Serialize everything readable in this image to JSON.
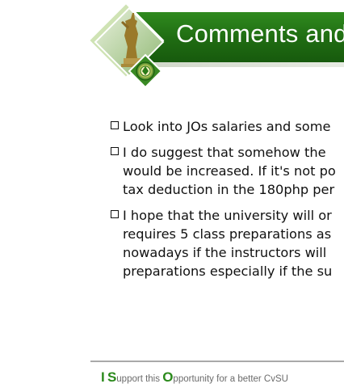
{
  "slide": {
    "title": "Comments and",
    "bullets": [
      {
        "lines": [
          "Look into JOs salaries and some"
        ]
      },
      {
        "lines": [
          "I do suggest that somehow the",
          "would be increased. If it's not po",
          "tax deduction in the 180php per"
        ]
      },
      {
        "lines": [
          "I hope that the university will or",
          "requires 5 class preparations as",
          "nowadays if the instructors will",
          "preparations especially if the su"
        ]
      }
    ],
    "footer": {
      "letter_i": "I",
      "letter_s": "S",
      "text_s": "upport this ",
      "letter_o": "O",
      "text_o": "pportunity for a better CvSU"
    }
  },
  "colors": {
    "banner_green": "#1f6b12",
    "footer_green": "#2b8a1c",
    "footer_gray": "#6b6b6b"
  },
  "icons": [
    "checkbox-bullet-icon",
    "university-seal-icon",
    "statue-icon"
  ]
}
